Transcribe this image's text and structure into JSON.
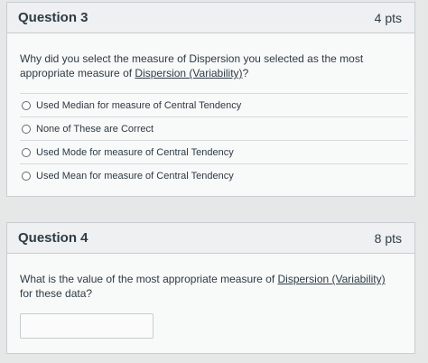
{
  "question3": {
    "title": "Question 3",
    "points": "4 pts",
    "text_before": "Why did you select the measure of Dispersion you selected as the most appropriate measure of ",
    "text_link": "Dispersion (Variability)",
    "text_after": "?",
    "answers": [
      "Used Median for measure of Central Tendency",
      "None of These are Correct",
      "Used Mode for measure of Central Tendency",
      "Used Mean for measure of Central Tendency"
    ]
  },
  "question4": {
    "title": "Question 4",
    "points": "8 pts",
    "text_before": "What is the value of the most appropriate measure of ",
    "text_link": "Dispersion (Variability)",
    "text_after": " for these data?",
    "answer_value": ""
  },
  "colors": {
    "page_bg": "#e6e8e8",
    "card_bg": "#f8f9f9",
    "header_bg": "#eef0f1",
    "text": "#2d3b45",
    "border": "#c7cdd1"
  }
}
